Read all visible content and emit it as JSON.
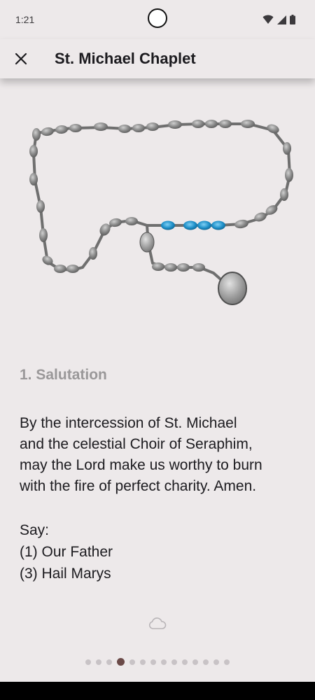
{
  "status": {
    "time": "1:21"
  },
  "app_bar": {
    "title": "St. Michael Chaplet",
    "close_icon": "close-icon"
  },
  "colors": {
    "background": "#ede9ea",
    "bead": "#808080",
    "highlight_bead": "#1e8fc8",
    "active_dot": "#6b4a48",
    "inactive_dot": "#c8c3c6",
    "heading": "#9a9899"
  },
  "step": {
    "heading": "1. Salutation",
    "prayer_lines": [
      "By the intercession of St. Michael",
      "and the celestial Choir of Seraphim,",
      "may the Lord make us worthy to burn",
      "with the fire of perfect charity. Amen."
    ],
    "say_label": "Say:",
    "say_items": [
      "(1) Our Father",
      "(3) Hail Marys"
    ]
  },
  "pager": {
    "total_pages": 14,
    "current_page": 4
  }
}
